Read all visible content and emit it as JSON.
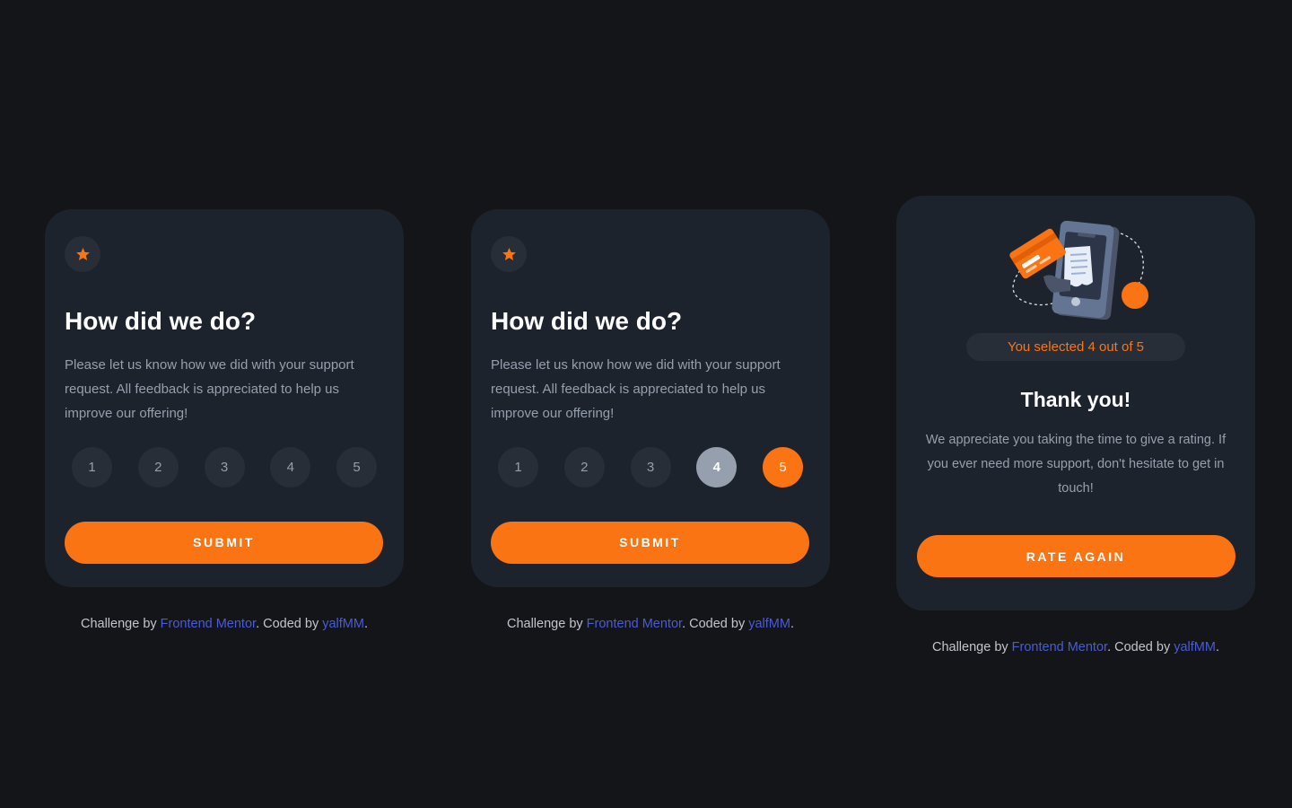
{
  "colors": {
    "page_background": "#131518",
    "card_background": "#1d232c",
    "accent_orange": "#fb7413",
    "muted_grey": "#969fad",
    "link_blue": "#4a5bd9"
  },
  "rating_card_1": {
    "icon": "star-icon",
    "title": "How did we do?",
    "description": "Please let us know how we did with your support request. All feedback is appreciated to help us improve our offering!",
    "ratings": [
      "1",
      "2",
      "3",
      "4",
      "5"
    ],
    "submit_label": "SUBMIT"
  },
  "rating_card_2": {
    "icon": "star-icon",
    "title": "How did we do?",
    "description": "Please let us know how we did with your support request. All feedback is appreciated to help us improve our offering!",
    "ratings": [
      "1",
      "2",
      "3",
      "4",
      "5"
    ],
    "hovered_rating": "4",
    "selected_rating": "5",
    "submit_label": "SUBMIT"
  },
  "thank_you_card": {
    "illustration": "payment-phone-illustration",
    "selected_text": "You selected 4 out of 5",
    "title": "Thank you!",
    "description": "We appreciate you taking the time to give a rating. If you ever need more support, don't hesitate to get in touch!",
    "button_label": "RATE AGAIN"
  },
  "attribution": {
    "prefix": "Challenge by ",
    "challenge_link": "Frontend Mentor",
    "middle": ". Coded by ",
    "author_link": "yalfMM",
    "suffix": "."
  }
}
